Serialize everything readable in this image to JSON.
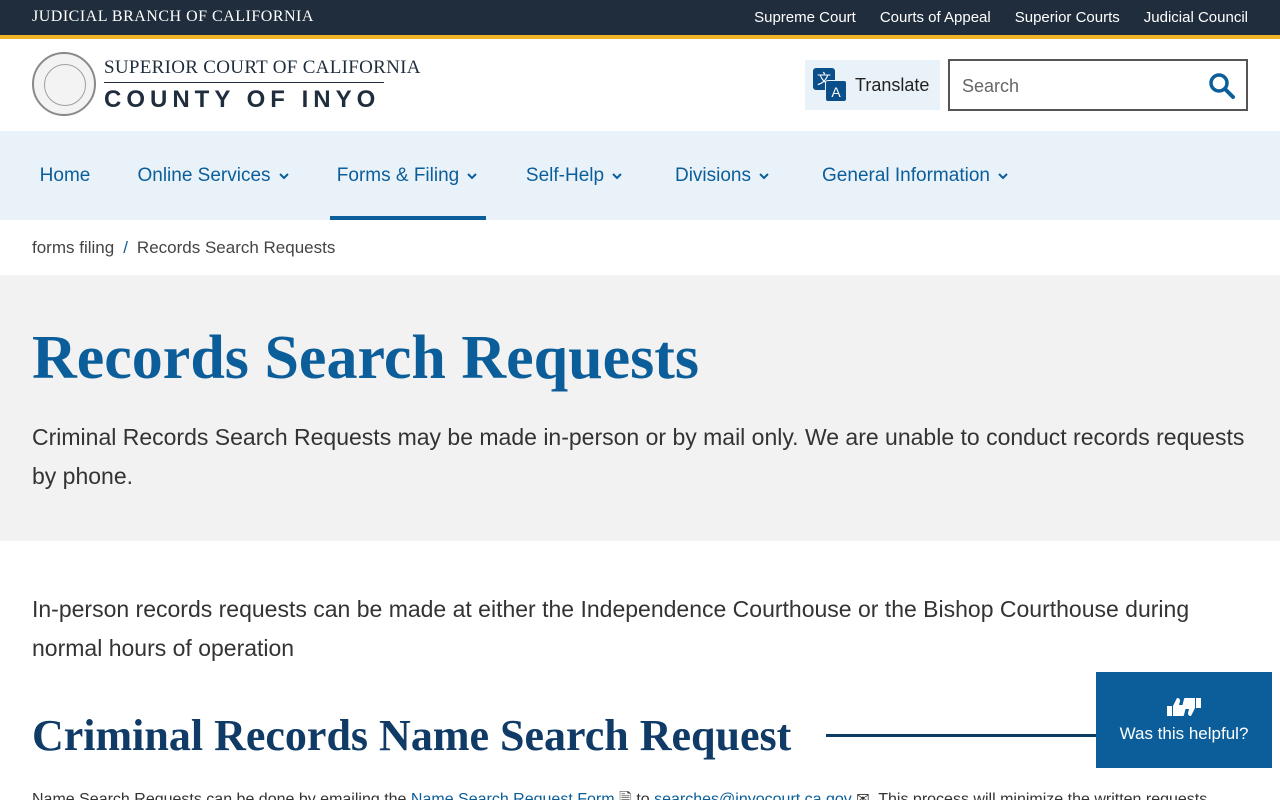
{
  "topbar": {
    "branch": "JUDICIAL BRANCH OF CALIFORNIA",
    "links": [
      "Supreme Court",
      "Courts of Appeal",
      "Superior Courts",
      "Judicial Council"
    ]
  },
  "header": {
    "court_line1": "SUPERIOR COURT OF CALIFORNIA",
    "court_line2": "COUNTY OF INYO",
    "translate_label": "Translate",
    "search_placeholder": "Search"
  },
  "nav": {
    "home": "Home",
    "online_services": "Online Services",
    "forms_filing": "Forms & Filing",
    "self_help": "Self-Help",
    "divisions": "Divisions",
    "general_information": "General Information",
    "active": "Forms & Filing"
  },
  "breadcrumb": {
    "parent": "forms filing",
    "separator": "/",
    "current": "Records Search Requests"
  },
  "main": {
    "title": "Records Search Requests",
    "intro": "Criminal Records Search Requests may be made in-person or by mail only. We are unable to conduct records requests by phone.",
    "in_person": "In-person records requests can be made at either the Independence Courthouse or the Bishop Courthouse during normal hours of operation",
    "section_title": "Criminal Records Name Search Request",
    "section_text_start": "Name Search Requests can be done by emailing the",
    "section_link_form": "Name Search Request Form",
    "section_text_mid": "to",
    "section_link_email": "searches@inyocourt.ca.gov",
    "section_text_end": ". This process will minimize the written requests"
  },
  "helpful": {
    "label": "Was this helpful?"
  },
  "colors": {
    "topbar": "#1f2d3d",
    "accent_gold": "#f0b429",
    "link_blue": "#0b5e9a",
    "nav_bg": "#eaf2f9",
    "hero_bg": "#f2f2f2"
  }
}
